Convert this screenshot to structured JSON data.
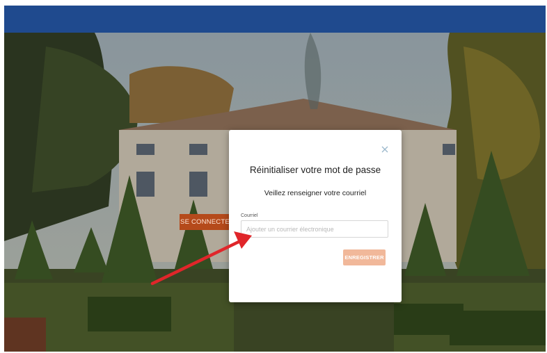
{
  "header": {
    "background_color": "#1f4a8e"
  },
  "login": {
    "connect_label": "SE CONNECTER",
    "connect_color": "#b54a1b"
  },
  "modal": {
    "title": "Réinitialiser votre mot de passe",
    "subtitle": "Veillez renseigner votre courriel",
    "close_icon": "close-icon",
    "email": {
      "label": "Courriel",
      "placeholder": "Ajouter un courrier électronique",
      "value": ""
    },
    "save_label": "ENREGISTRER",
    "save_color": "#f1b89a"
  },
  "annotation": {
    "arrow_icon": "red-arrow-icon",
    "arrow_color": "#e0262a"
  }
}
